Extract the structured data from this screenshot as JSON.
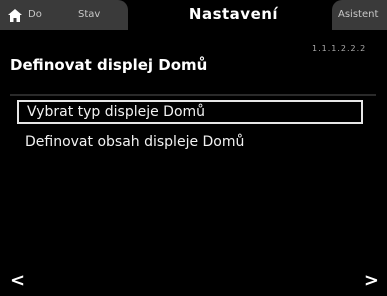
{
  "tabs": {
    "home_label": "Do",
    "second_label": "Stav",
    "active_label": "Nastavení",
    "right_label": "Asistent"
  },
  "subinfo": "1.1.1.2.2.2",
  "page_title": "Definovat displej Domů",
  "menu": {
    "items": [
      {
        "label": "Vybrat typ displeje Domů"
      },
      {
        "label": "Definovat obsah displeje Domů"
      }
    ]
  },
  "nav": {
    "left_arrow": "<",
    "right_arrow": ">"
  },
  "colors": {
    "background": "#000000",
    "tab_inactive": "#3a3a3a",
    "text": "#ffffff",
    "selection_border": "#e6e6e6"
  },
  "icons": [
    "home-icon"
  ]
}
